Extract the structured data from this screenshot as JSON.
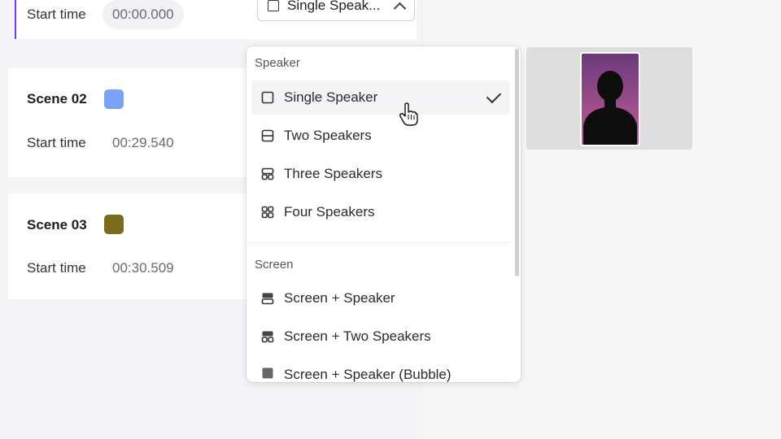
{
  "scene1": {
    "start_label": "Start time",
    "start_time": "00:00.000",
    "layout_selected": "Single Speak..."
  },
  "scene2": {
    "title": "Scene 02",
    "color": "#7aa2f7",
    "start_label": "Start time",
    "start_time": "00:29.540"
  },
  "scene3": {
    "title": "Scene 03",
    "color": "#7b6b1c",
    "start_label": "Start time",
    "start_time": "00:30.509"
  },
  "dropdown": {
    "speaker_group": "Speaker",
    "speaker_options": [
      {
        "label": "Single Speaker",
        "icon": "single-square-icon",
        "selected": true
      },
      {
        "label": "Two Speakers",
        "icon": "two-split-icon"
      },
      {
        "label": "Three Speakers",
        "icon": "three-split-icon"
      },
      {
        "label": "Four Speakers",
        "icon": "four-grid-icon"
      }
    ],
    "screen_group": "Screen",
    "screen_options": [
      {
        "label": "Screen + Speaker",
        "icon": "screen-speaker-icon"
      },
      {
        "label": "Screen + Two Speakers",
        "icon": "screen-two-speakers-icon"
      },
      {
        "label": "Screen + Speaker (Bubble)",
        "icon": "screen-bubble-icon"
      }
    ]
  }
}
